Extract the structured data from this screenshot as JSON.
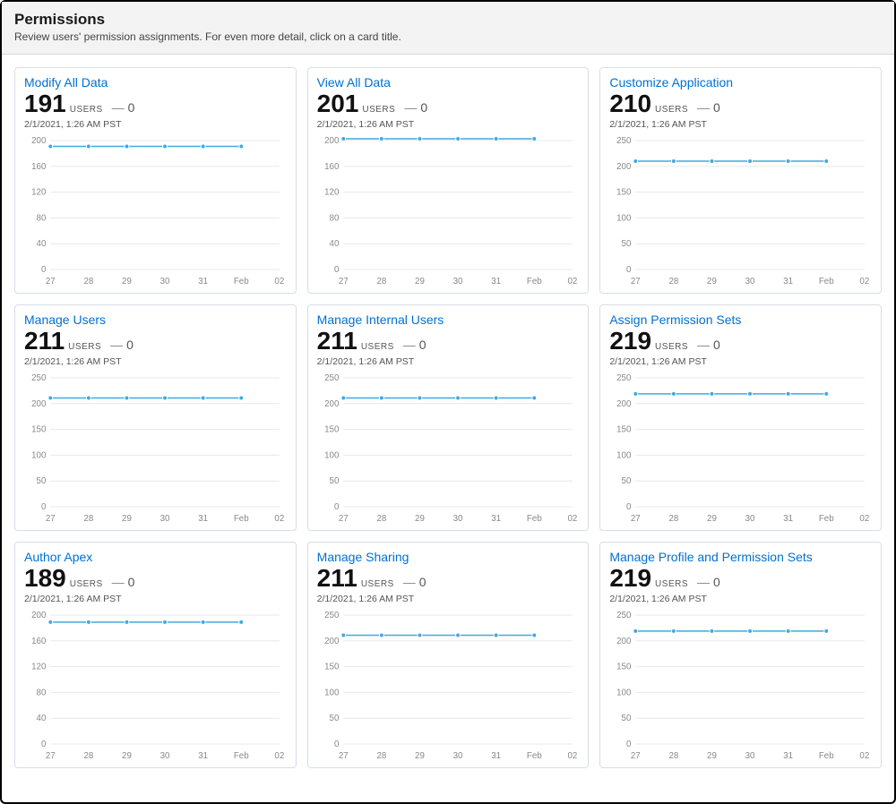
{
  "header": {
    "title": "Permissions",
    "subtitle": "Review users' permission assignments. For even more detail, click on a card title."
  },
  "common": {
    "users_label": "USERS",
    "dash": "—",
    "x_ticks": [
      "27",
      "28",
      "29",
      "30",
      "31",
      "Feb",
      "02"
    ]
  },
  "cards": [
    {
      "id": "modify-all-data",
      "title": "Modify All Data",
      "value": "191",
      "delta": "0",
      "timestamp": "2/1/2021, 1:26 AM PST",
      "chart_data": {
        "type": "line",
        "x": [
          "27",
          "28",
          "29",
          "30",
          "31",
          "Feb",
          "02"
        ],
        "values": [
          191,
          191,
          191,
          191,
          191,
          191,
          null
        ],
        "ylim": [
          0,
          200
        ],
        "y_ticks": [
          0,
          40,
          80,
          120,
          160,
          200
        ]
      }
    },
    {
      "id": "view-all-data",
      "title": "View All Data",
      "value": "201",
      "delta": "0",
      "timestamp": "2/1/2021, 1:26 AM PST",
      "chart_data": {
        "type": "line",
        "x": [
          "27",
          "28",
          "29",
          "30",
          "31",
          "Feb",
          "02"
        ],
        "values": [
          201,
          201,
          201,
          201,
          201,
          201,
          null
        ],
        "ylim": [
          0,
          200
        ],
        "y_ticks": [
          0,
          40,
          80,
          120,
          160,
          200
        ]
      }
    },
    {
      "id": "customize-application",
      "title": "Customize Application",
      "value": "210",
      "delta": "0",
      "timestamp": "2/1/2021, 1:26 AM PST",
      "chart_data": {
        "type": "line",
        "x": [
          "27",
          "28",
          "29",
          "30",
          "31",
          "Feb",
          "02"
        ],
        "values": [
          210,
          210,
          210,
          210,
          210,
          210,
          null
        ],
        "ylim": [
          0,
          250
        ],
        "y_ticks": [
          0,
          50,
          100,
          150,
          200,
          250
        ]
      }
    },
    {
      "id": "manage-users",
      "title": "Manage Users",
      "value": "211",
      "delta": "0",
      "timestamp": "2/1/2021, 1:26 AM PST",
      "chart_data": {
        "type": "line",
        "x": [
          "27",
          "28",
          "29",
          "30",
          "31",
          "Feb",
          "02"
        ],
        "values": [
          211,
          211,
          211,
          211,
          211,
          211,
          null
        ],
        "ylim": [
          0,
          250
        ],
        "y_ticks": [
          0,
          50,
          100,
          150,
          200,
          250
        ]
      }
    },
    {
      "id": "manage-internal-users",
      "title": "Manage Internal Users",
      "value": "211",
      "delta": "0",
      "timestamp": "2/1/2021, 1:26 AM PST",
      "chart_data": {
        "type": "line",
        "x": [
          "27",
          "28",
          "29",
          "30",
          "31",
          "Feb",
          "02"
        ],
        "values": [
          211,
          211,
          211,
          211,
          211,
          211,
          null
        ],
        "ylim": [
          0,
          250
        ],
        "y_ticks": [
          0,
          50,
          100,
          150,
          200,
          250
        ]
      }
    },
    {
      "id": "assign-permission-sets",
      "title": "Assign Permission Sets",
      "value": "219",
      "delta": "0",
      "timestamp": "2/1/2021, 1:26 AM PST",
      "chart_data": {
        "type": "line",
        "x": [
          "27",
          "28",
          "29",
          "30",
          "31",
          "Feb",
          "02"
        ],
        "values": [
          219,
          219,
          219,
          219,
          219,
          219,
          null
        ],
        "ylim": [
          0,
          250
        ],
        "y_ticks": [
          0,
          50,
          100,
          150,
          200,
          250
        ]
      }
    },
    {
      "id": "author-apex",
      "title": "Author Apex",
      "value": "189",
      "delta": "0",
      "timestamp": "2/1/2021, 1:26 AM PST",
      "chart_data": {
        "type": "line",
        "x": [
          "27",
          "28",
          "29",
          "30",
          "31",
          "Feb",
          "02"
        ],
        "values": [
          189,
          189,
          189,
          189,
          189,
          189,
          null
        ],
        "ylim": [
          0,
          200
        ],
        "y_ticks": [
          0,
          40,
          80,
          120,
          160,
          200
        ]
      }
    },
    {
      "id": "manage-sharing",
      "title": "Manage Sharing",
      "value": "211",
      "delta": "0",
      "timestamp": "2/1/2021, 1:26 AM PST",
      "chart_data": {
        "type": "line",
        "x": [
          "27",
          "28",
          "29",
          "30",
          "31",
          "Feb",
          "02"
        ],
        "values": [
          211,
          211,
          211,
          211,
          211,
          211,
          null
        ],
        "ylim": [
          0,
          250
        ],
        "y_ticks": [
          0,
          50,
          100,
          150,
          200,
          250
        ]
      }
    },
    {
      "id": "manage-profile-permission-sets",
      "title": "Manage Profile and Permission Sets",
      "value": "219",
      "delta": "0",
      "timestamp": "2/1/2021, 1:26 AM PST",
      "chart_data": {
        "type": "line",
        "x": [
          "27",
          "28",
          "29",
          "30",
          "31",
          "Feb",
          "02"
        ],
        "values": [
          219,
          219,
          219,
          219,
          219,
          219,
          null
        ],
        "ylim": [
          0,
          250
        ],
        "y_ticks": [
          0,
          50,
          100,
          150,
          200,
          250
        ]
      }
    }
  ]
}
